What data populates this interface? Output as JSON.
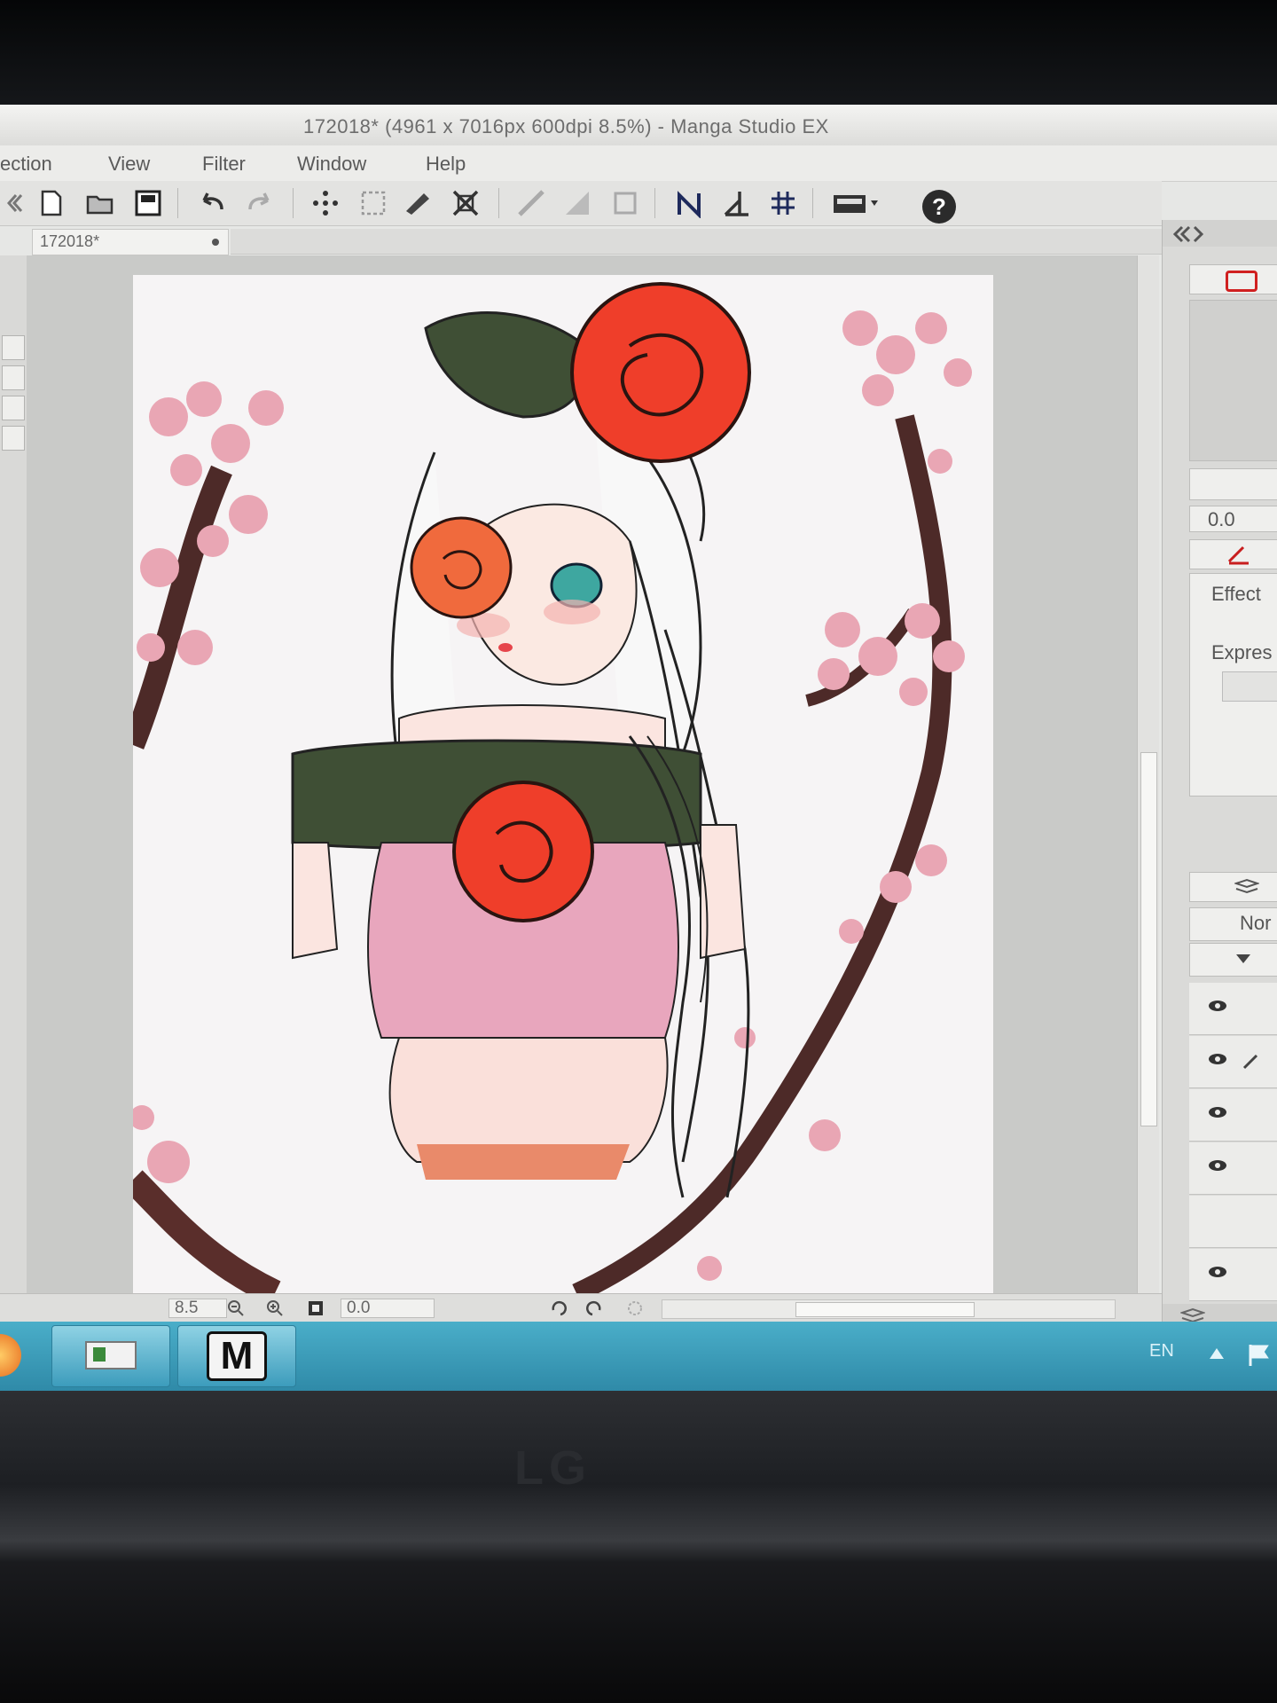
{
  "window": {
    "title": "172018* (4961 x 7016px 600dpi 8.5%)  -  Manga Studio EX"
  },
  "menu": {
    "items": [
      "ection",
      "View",
      "Filter",
      "Window",
      "Help"
    ]
  },
  "toolbar": {
    "help_label": "?"
  },
  "document": {
    "tab_label": "172018*"
  },
  "statusbar": {
    "zoom_value": "8.5",
    "rotation_value": "0.0"
  },
  "right_panel": {
    "value_field": "0.0",
    "effect_label": "Effect",
    "expression_label": "Expres",
    "blend_mode": "Nor"
  },
  "taskbar": {
    "app_label": "M",
    "language": "EN"
  },
  "monitor": {
    "brand": "LG"
  },
  "colors": {
    "taskbar": "#3a9cbd",
    "rose": "#ef3e2a",
    "leaf": "#3f4f35",
    "blossom": "#e9a6b4",
    "branch": "#4d2a28",
    "dress": "#e8a6bd"
  }
}
